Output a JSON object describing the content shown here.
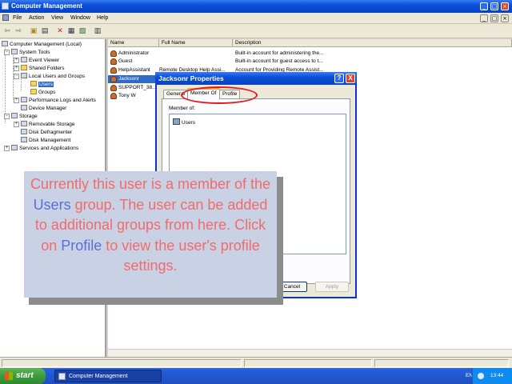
{
  "window": {
    "title": "Computer Management"
  },
  "menu": [
    "File",
    "Action",
    "View",
    "Window",
    "Help"
  ],
  "toolbar_icons": [
    "back-arrow-icon",
    "forward-arrow-icon",
    "up-folder-icon",
    "show-tree-icon",
    "delete-icon",
    "properties-icon",
    "refresh-icon",
    "export-icon",
    "help-icon"
  ],
  "tree": {
    "root": "Computer Management (Local)",
    "system_tools": "System Tools",
    "event_viewer": "Event Viewer",
    "shared_folders": "Shared Folders",
    "local_users": "Local Users and Groups",
    "users": "Users",
    "groups": "Groups",
    "perf_logs": "Performance Logs and Alerts",
    "device_manager": "Device Manager",
    "storage": "Storage",
    "removable": "Removable Storage",
    "defrag": "Disk Defragmenter",
    "disk_mgmt": "Disk Management",
    "services": "Services and Applications"
  },
  "list": {
    "columns": [
      "Name",
      "Full Name",
      "Description"
    ],
    "rows": [
      {
        "name": "Administrator",
        "full": "",
        "desc": "Built-in account for administering the..."
      },
      {
        "name": "Guest",
        "full": "",
        "desc": "Built-in account for guest access to t..."
      },
      {
        "name": "HelpAssistant",
        "full": "Remote Desktop Help Assi...",
        "desc": "Account for Providing Remote Assist..."
      },
      {
        "name": "Jacksonr",
        "full": "",
        "desc": ""
      },
      {
        "name": "SUPPORT_38...",
        "full": "",
        "desc": ""
      },
      {
        "name": "Tony W",
        "full": "",
        "desc": ""
      }
    ]
  },
  "dialog": {
    "title": "Jacksonr Properties",
    "help": "?",
    "close": "X",
    "tabs": [
      "General",
      "Member Of",
      "Profile"
    ],
    "member_of_label": "Member of:",
    "groups": [
      "Users"
    ],
    "cancel": "Cancel",
    "apply": "Apply"
  },
  "callout": {
    "part1": "Currently this user is a member of the ",
    "users": "Users",
    "part2": " group. The user can be added to additional groups from here. Click on ",
    "profile": "Profile",
    "part3": " to view the user's profile settings."
  },
  "taskbar": {
    "start": "start",
    "task": "Computer Management",
    "lang": "EN",
    "clock": "13:44"
  },
  "colors": {
    "callout_text": "#f26b6b",
    "callout_highlight": "#5b6fd6",
    "callout_bg": "#c9d1e4",
    "annotation_circle": "#e8161b"
  }
}
